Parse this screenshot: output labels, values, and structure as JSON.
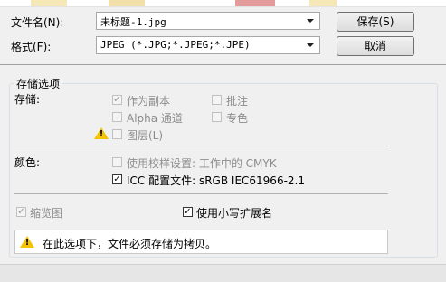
{
  "colors": {
    "warning": "#f4c400",
    "thumb_a": "#f6e7b6",
    "thumb_b": "#d9d9d9",
    "thumb_c": "#e8a9a9",
    "thumb_d": "#f6e7b6"
  },
  "file_name": {
    "label": "文件名(N):",
    "value": "未标题-1.jpg"
  },
  "format": {
    "label": "格式(F):",
    "value": "JPEG (*.JPG;*.JPEG;*.JPE)"
  },
  "buttons": {
    "save": "保存(S)",
    "cancel": "取消"
  },
  "options": {
    "group_title": "存储选项",
    "storage": {
      "label": "存储:",
      "as_copy": {
        "label": "作为副本",
        "checked": true,
        "enabled": false
      },
      "annotations": {
        "label": "批注",
        "checked": false,
        "enabled": false
      },
      "alpha_channels": {
        "label": "Alpha 通道",
        "checked": false,
        "enabled": false
      },
      "spot_colors": {
        "label": "专色",
        "checked": false,
        "enabled": false
      },
      "layers": {
        "label": "图层(L)",
        "checked": false,
        "enabled": false
      }
    },
    "color": {
      "label": "颜色:",
      "use_proof_setup": {
        "label": "使用校样设置: 工作中的 CMYK",
        "checked": false,
        "enabled": false
      },
      "icc_profile": {
        "label": "ICC 配置文件: sRGB IEC61966-2.1",
        "checked": true,
        "enabled": true
      }
    },
    "thumbnail": {
      "label": "缩览图",
      "checked": true,
      "enabled": false
    },
    "lowercase_ext": {
      "label": "使用小写扩展名",
      "checked": true,
      "enabled": true
    }
  },
  "warning_message": "在此选项下，文件必须存储为拷贝。"
}
